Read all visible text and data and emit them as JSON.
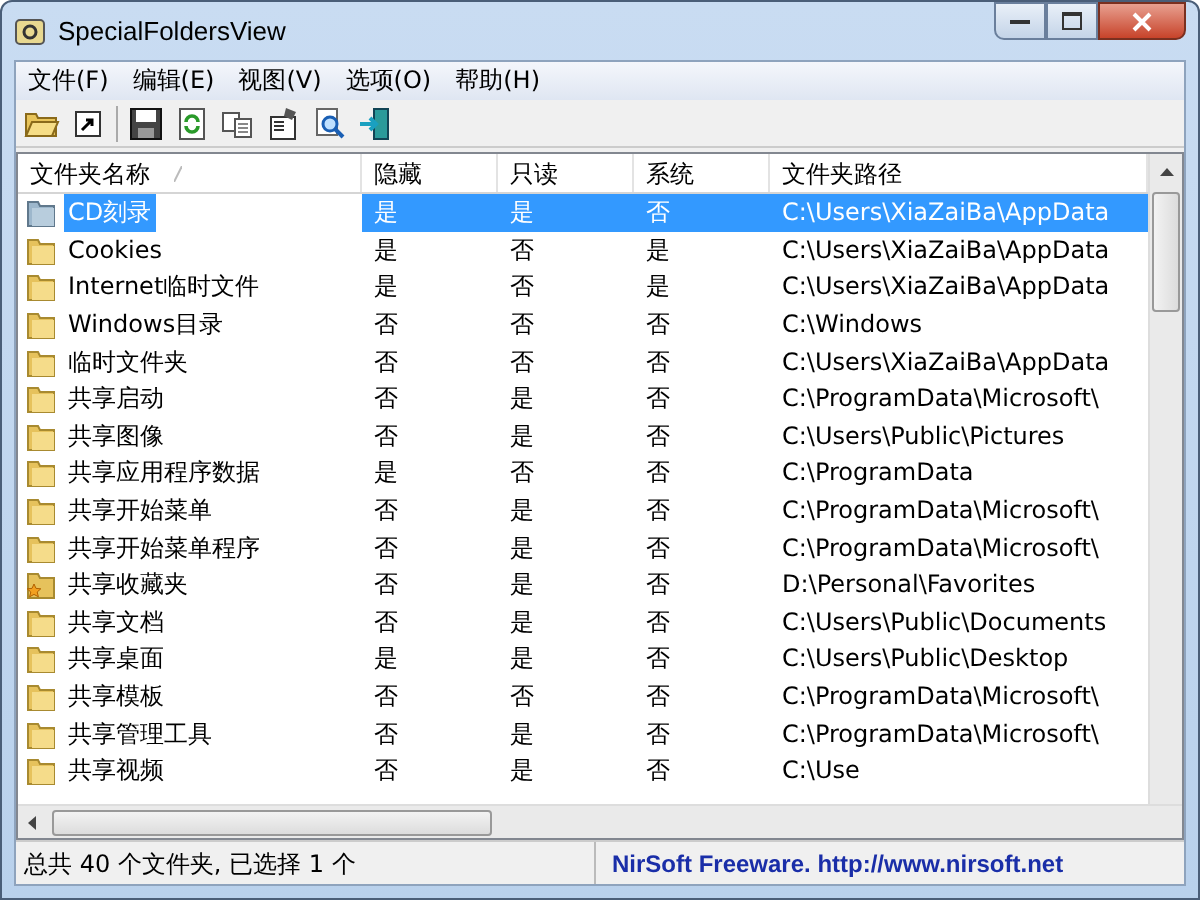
{
  "window": {
    "title": "SpecialFoldersView"
  },
  "menu": [
    "文件(F)",
    "编辑(E)",
    "视图(V)",
    "选项(O)",
    "帮助(H)"
  ],
  "toolbar": [
    {
      "kind": "open"
    },
    {
      "kind": "shortcut"
    },
    {
      "kind": "sep"
    },
    {
      "kind": "save"
    },
    {
      "kind": "refresh"
    },
    {
      "kind": "copy"
    },
    {
      "kind": "properties"
    },
    {
      "kind": "find"
    },
    {
      "kind": "exit"
    }
  ],
  "table": {
    "columns": [
      "文件夹名称",
      "隐藏",
      "只读",
      "系统",
      "文件夹路径"
    ],
    "rows": [
      {
        "kind": "cd",
        "selected": true,
        "cells": [
          "CD刻录",
          "是",
          "是",
          "否",
          "C:\\Users\\XiaZaiBa\\AppData"
        ]
      },
      {
        "kind": "folder",
        "selected": false,
        "cells": [
          "Cookies",
          "是",
          "否",
          "是",
          "C:\\Users\\XiaZaiBa\\AppData"
        ]
      },
      {
        "kind": "folder",
        "selected": false,
        "cells": [
          "Internet临时文件",
          "是",
          "否",
          "是",
          "C:\\Users\\XiaZaiBa\\AppData"
        ]
      },
      {
        "kind": "folder",
        "selected": false,
        "cells": [
          "Windows目录",
          "否",
          "否",
          "否",
          "C:\\Windows"
        ]
      },
      {
        "kind": "folder",
        "selected": false,
        "cells": [
          "临时文件夹",
          "否",
          "否",
          "否",
          "C:\\Users\\XiaZaiBa\\AppData"
        ]
      },
      {
        "kind": "folder",
        "selected": false,
        "cells": [
          "共享启动",
          "否",
          "是",
          "否",
          "C:\\ProgramData\\Microsoft\\"
        ]
      },
      {
        "kind": "folder",
        "selected": false,
        "cells": [
          "共享图像",
          "否",
          "是",
          "否",
          "C:\\Users\\Public\\Pictures"
        ]
      },
      {
        "kind": "folder",
        "selected": false,
        "cells": [
          "共享应用程序数据",
          "是",
          "否",
          "否",
          "C:\\ProgramData"
        ]
      },
      {
        "kind": "folder",
        "selected": false,
        "cells": [
          "共享开始菜单",
          "否",
          "是",
          "否",
          "C:\\ProgramData\\Microsoft\\"
        ]
      },
      {
        "kind": "folder",
        "selected": false,
        "cells": [
          "共享开始菜单程序",
          "否",
          "是",
          "否",
          "C:\\ProgramData\\Microsoft\\"
        ]
      },
      {
        "kind": "favorites",
        "selected": false,
        "cells": [
          "共享收藏夹",
          "否",
          "是",
          "否",
          "D:\\Personal\\Favorites"
        ]
      },
      {
        "kind": "folder",
        "selected": false,
        "cells": [
          "共享文档",
          "否",
          "是",
          "否",
          "C:\\Users\\Public\\Documents"
        ]
      },
      {
        "kind": "folder",
        "selected": false,
        "cells": [
          "共享桌面",
          "是",
          "是",
          "否",
          "C:\\Users\\Public\\Desktop"
        ]
      },
      {
        "kind": "folder",
        "selected": false,
        "cells": [
          "共享模板",
          "否",
          "否",
          "否",
          "C:\\ProgramData\\Microsoft\\"
        ]
      },
      {
        "kind": "folder",
        "selected": false,
        "cells": [
          "共享管理工具",
          "否",
          "是",
          "否",
          "C:\\ProgramData\\Microsoft\\"
        ]
      },
      {
        "kind": "folder",
        "selected": false,
        "cells": [
          "共享视频",
          "否",
          "是",
          "否",
          "C:\\Use"
        ]
      }
    ]
  },
  "status_bar": {
    "summary": "总共 40 个文件夹, 已选择 1 个",
    "credit": "NirSoft Freeware.  http://www.nirsoft.net"
  }
}
